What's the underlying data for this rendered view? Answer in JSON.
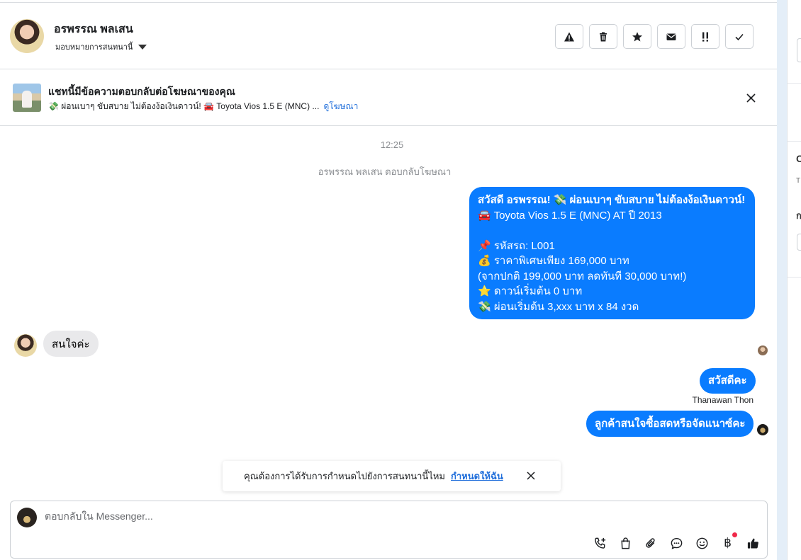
{
  "header": {
    "contact_name": "อรพรรณ พลเสน",
    "assign_label": "มอบหมายการสนทนานี้",
    "actions": [
      "spam-icon",
      "trash-icon",
      "star-icon",
      "envelope-icon",
      "follow-up-icon",
      "done-icon"
    ]
  },
  "ad_banner": {
    "title": "แชทนี้มีข้อความตอบกลับต่อโฆษณาของคุณ",
    "snippet": "💸 ผ่อนเบาๆ ขับสบาย ไม่ต้องง้อเงินดาวน์! 🚘 Toyota Vios 1.5 E (MNC) ...",
    "link": "ดูโฆษณา"
  },
  "chat": {
    "timestamp": "12:25",
    "system_note": "อรพรรณ พลเสน ตอบกลับโฆษณา",
    "ad_message_lines": [
      "สวัสดี อรพรรณ! 💸 ผ่อนเบาๆ ขับสบาย ไม่ต้องง้อเงินดาวน์!",
      "🚘 Toyota Vios 1.5 E (MNC) AT ปี 2013",
      "",
      "📌 รหัสรถ: L001",
      "💰 ราคาพิเศษเพียง 169,000 บาท",
      "(จากปกติ 199,000 บาท ลดทันที 30,000 บาท!)",
      "⭐ ดาวน์เริ่มต้น 0 บาท",
      "💸 ผ่อนเริ่มต้น 3,xxx บาท x 84 งวด"
    ],
    "incoming_message": "สนใจค่ะ",
    "reply_1": "สวัสดีคะ",
    "reply_sender": "Thanawan Thon",
    "reply_2": "ลูกค้าสนใจซื้อสดหรือจัดแนาซ์คะ"
  },
  "reminder": {
    "text": "คุณต้องการได้รับการกำหนดไปยังการสนทนานี้ไหม",
    "action": "กำหนดให้ฉัน"
  },
  "composer": {
    "placeholder": "ตอบกลับใน Messenger...",
    "currency_glyph": "฿",
    "tools": [
      "call-add-icon",
      "shopping-bag-icon",
      "paperclip-icon",
      "chat-bubble-icon",
      "emoji-icon",
      "baht-icon",
      "thumbs-up-icon"
    ]
  },
  "side_panel": {
    "letters": [
      "T",
      "ก",
      "C"
    ]
  },
  "colors": {
    "accent": "#0a7cff",
    "link": "#216fdb",
    "incoming_bubble": "#e9e9eb",
    "notification_dot": "#f02849"
  }
}
